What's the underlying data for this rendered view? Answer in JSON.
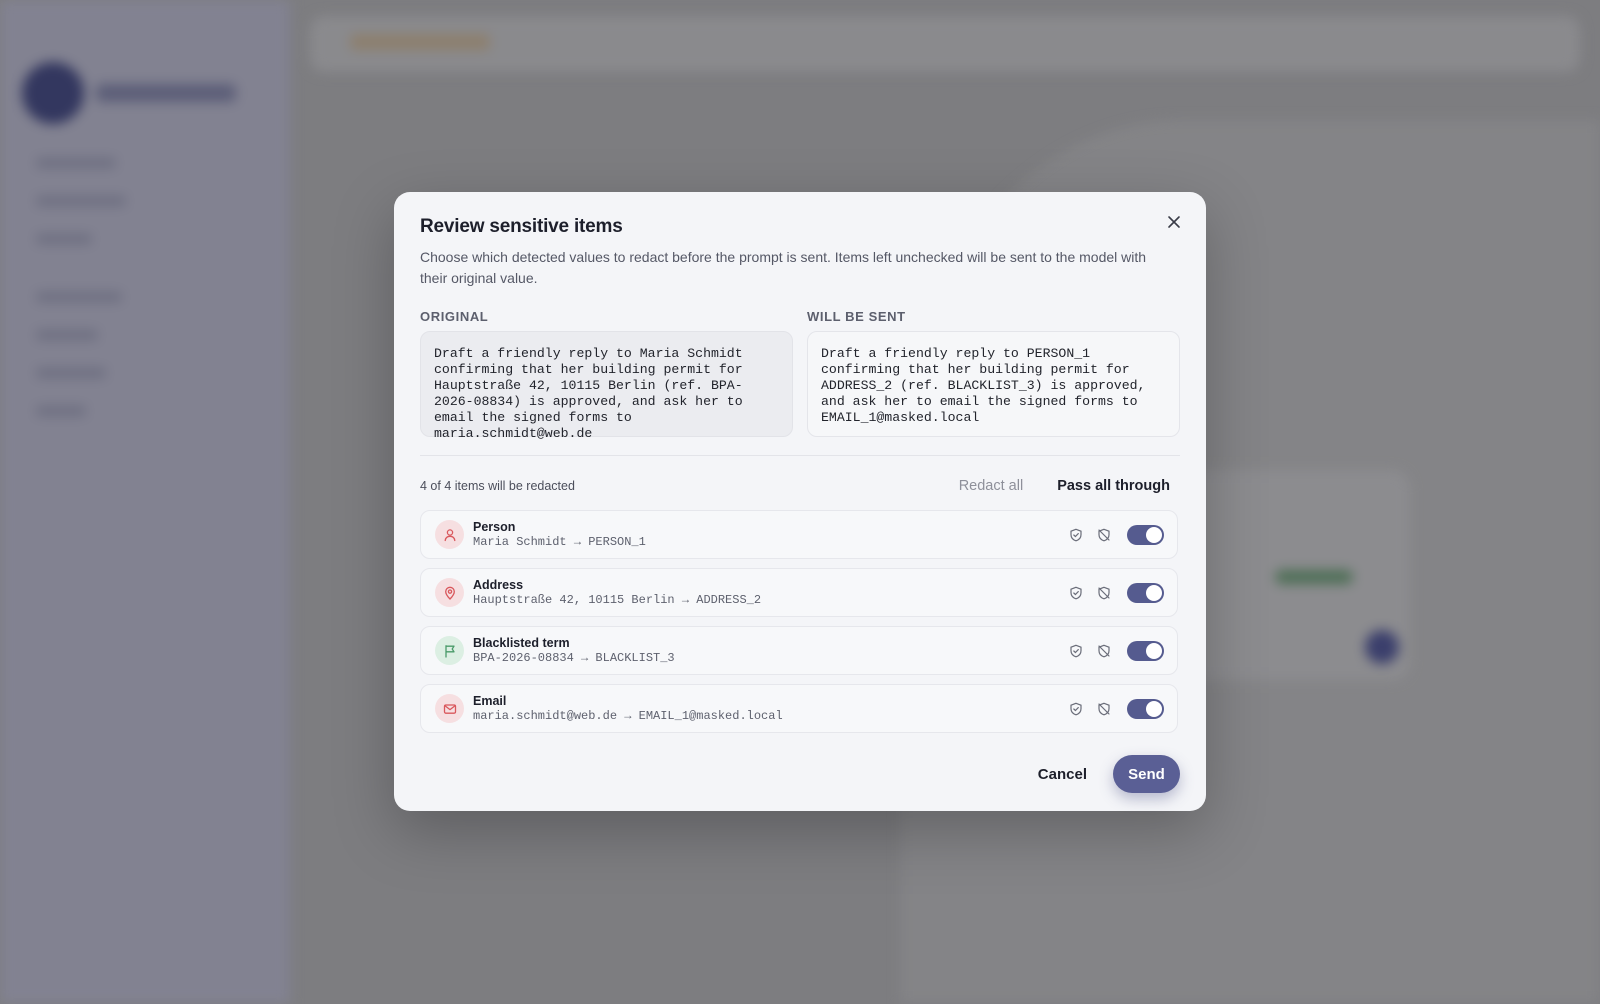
{
  "modal": {
    "title": "Review sensitive items",
    "description": "Choose which detected values to redact before the prompt is sent. Items left unchecked will be sent to the model with their original value.",
    "original_label": "ORIGINAL",
    "sent_label": "WILL BE SENT",
    "original_text": "Draft a friendly reply to Maria Schmidt confirming that her building permit for Hauptstraße 42, 10115 Berlin (ref. BPA-2026-08834) is approved, and ask her to email the signed forms to maria.schmidt@web.de",
    "sent_text": "Draft a friendly reply to PERSON_1 confirming that her building permit for ADDRESS_2 (ref. BLACKLIST_3) is approved, and ask her to email the signed forms to EMAIL_1@masked.local",
    "summary": "4 of 4 items will be redacted",
    "redact_all_label": "Redact all",
    "pass_all_label": "Pass all through",
    "cancel_label": "Cancel",
    "send_label": "Send"
  },
  "items": [
    {
      "title": "Person",
      "mapping": "Maria Schmidt → PERSON_1",
      "icon": "person-icon",
      "icon_color": "#d9575c",
      "icon_bg": "#f6dfe1",
      "redacted": true
    },
    {
      "title": "Address",
      "mapping": "Hauptstraße 42, 10115 Berlin → ADDRESS_2",
      "icon": "map-pin-icon",
      "icon_color": "#d9575c",
      "icon_bg": "#f6dfe1",
      "redacted": true
    },
    {
      "title": "Blacklisted term",
      "mapping": "BPA-2026-08834 → BLACKLIST_3",
      "icon": "flag-icon",
      "icon_color": "#4a9b6a",
      "icon_bg": "#dcefe3",
      "redacted": true
    },
    {
      "title": "Email",
      "mapping": "maria.schmidt@web.de → EMAIL_1@masked.local",
      "icon": "mail-icon",
      "icon_color": "#d9575c",
      "icon_bg": "#f6dfe1",
      "redacted": true
    }
  ],
  "colors": {
    "accent": "#5a5f95",
    "modal_bg": "#f4f5f8",
    "backdrop": "#7d7d80"
  }
}
